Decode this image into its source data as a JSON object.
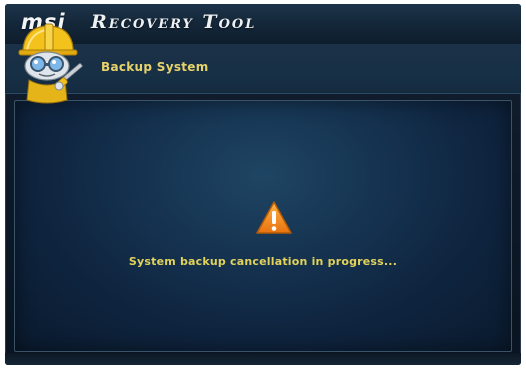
{
  "window": {
    "brand": "msi",
    "app_title": "Recovery Tool"
  },
  "header": {
    "section_title": "Backup System",
    "mascot_icon": "robot-engineer-icon"
  },
  "main": {
    "status_icon": "warning-icon",
    "status_message": "System backup cancellation in progress..."
  },
  "colors": {
    "accent_text": "#e3d35a",
    "warning": "#f0891c",
    "background": "#0f2540"
  }
}
